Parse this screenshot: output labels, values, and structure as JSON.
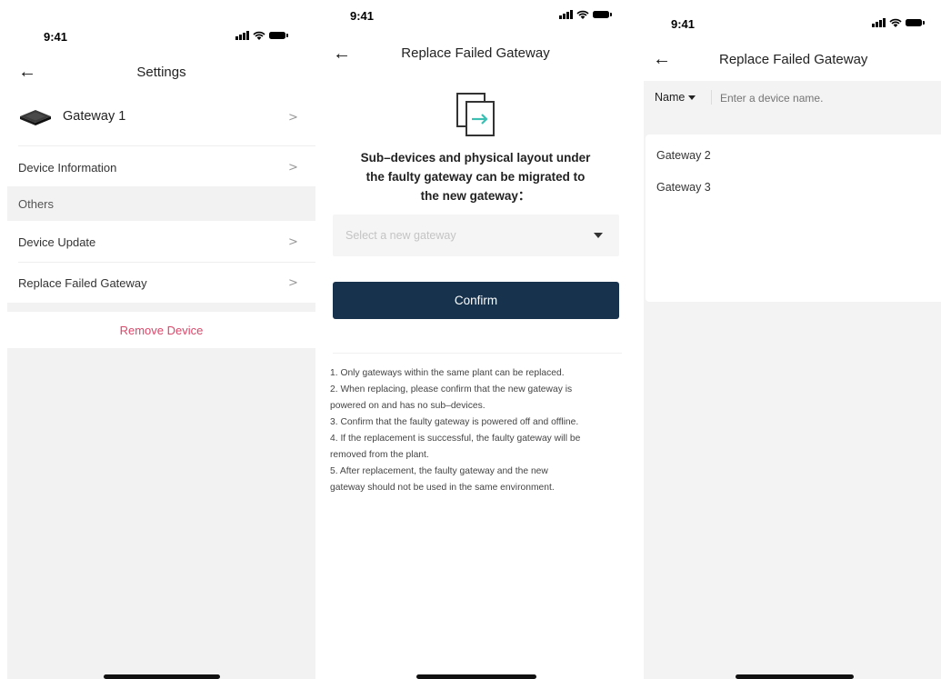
{
  "status_bar": {
    "time": "9:41"
  },
  "settings": {
    "title": "Settings",
    "gateway_name": "Gateway 1",
    "rows": {
      "device_information": "Device Information",
      "others_section": "Others",
      "device_update": "Device Update",
      "replace_failed_gateway": "Replace Failed Gateway"
    },
    "remove_device": "Remove Device",
    "chevron": ">"
  },
  "replace": {
    "title": "Replace Failed Gateway",
    "heading_lines": [
      "Sub–devices and physical layout under",
      "the faulty gateway can be migrated to",
      "the new gateway："
    ],
    "select_placeholder": "Select a new gateway",
    "confirm_label": "Confirm",
    "notes": [
      "1. Only gateways within the same plant can be replaced.",
      "2. When replacing, please confirm that the new gateway is",
      "powered on and has no sub–devices.",
      "3. Confirm that the faulty gateway is powered off and offline.",
      "4. If the replacement is successful, the faulty gateway will be",
      "removed from the plant.",
      "5. After replacement, the faulty gateway and the new",
      "gateway should not be used in the same environment."
    ]
  },
  "select_gateway": {
    "title": "Replace Failed Gateway",
    "filter_label": "Name",
    "search_placeholder": "Enter a device name.",
    "results": [
      "Gateway 2",
      "Gateway 3"
    ]
  },
  "colors": {
    "primary": "#17324d",
    "danger": "#d9486a",
    "icon_teal": "#3bbfb3",
    "section_bg": "#f2f2f2"
  },
  "icons": [
    "back-arrow-icon",
    "signal-icon",
    "wifi-icon",
    "battery-icon",
    "gateway-device-icon",
    "chevron-right-icon",
    "replace-gateway-icon",
    "caret-down-icon"
  ]
}
